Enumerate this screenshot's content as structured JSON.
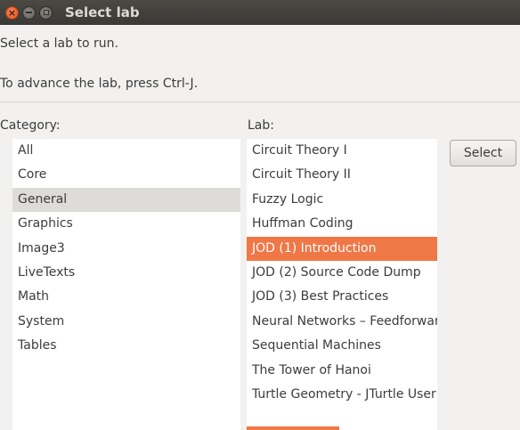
{
  "window": {
    "title": "Select lab",
    "buttons": [
      "close-icon",
      "minimize-icon",
      "maximize-icon"
    ]
  },
  "info": {
    "line1": "Select a lab to run.",
    "line2": "To advance the lab, press Ctrl-J."
  },
  "category": {
    "label": "Category:",
    "items": [
      "All",
      "Core",
      "General",
      "Graphics",
      "Image3",
      "LiveTexts",
      "Math",
      "System",
      "Tables"
    ],
    "selected": "General"
  },
  "lab": {
    "label": "Lab:",
    "items": [
      "Circuit Theory I",
      "Circuit Theory II",
      "Fuzzy Logic",
      "Huffman Coding",
      "JOD (1) Introduction",
      "JOD (2) Source Code Dump",
      "JOD (3) Best Practices",
      "Neural Networks – Feedforward",
      "Sequential Machines",
      "The Tower of Hanoi",
      "Turtle Geometry - JTurtle User"
    ],
    "selected": "JOD (1) Introduction"
  },
  "actions": {
    "select_label": "Select"
  },
  "colors": {
    "accent": "#f07746",
    "titlebar": "#3c3b37",
    "selection_gray": "#dedcd8"
  }
}
